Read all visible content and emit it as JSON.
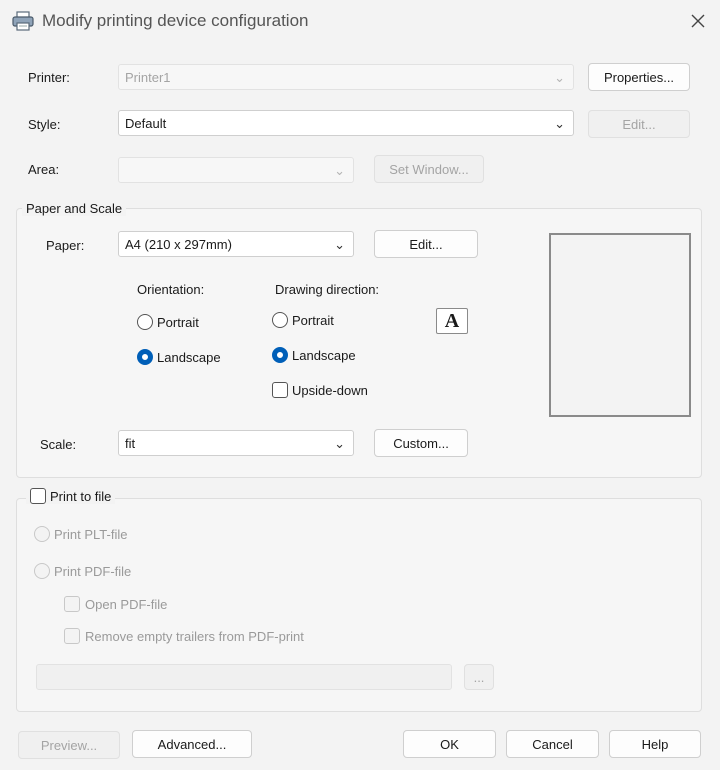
{
  "window": {
    "title": "Modify printing device configuration"
  },
  "printer": {
    "label": "Printer:",
    "value": "Printer1",
    "properties_label": "Properties..."
  },
  "style": {
    "label": "Style:",
    "value": "Default",
    "edit_label": "Edit..."
  },
  "area": {
    "label": "Area:",
    "value": "",
    "set_window_label": "Set Window..."
  },
  "paper_scale": {
    "title": "Paper and Scale",
    "paper_label": "Paper:",
    "paper_value": "A4 (210 x 297mm)",
    "paper_edit_label": "Edit...",
    "orientation": {
      "label": "Orientation:",
      "portrait": "Portrait",
      "landscape": "Landscape",
      "selected": "Landscape"
    },
    "drawing_direction": {
      "label": "Drawing direction:",
      "portrait": "Portrait",
      "landscape": "Landscape",
      "upside_down": "Upside-down",
      "selected": "Landscape",
      "upside_down_checked": false
    },
    "direction_icon": "A",
    "scale_label": "Scale:",
    "scale_value": "fit",
    "custom_label": "Custom..."
  },
  "print_to_file": {
    "label": "Print to file",
    "checked": false,
    "plt_label": "Print PLT-file",
    "pdf_label": "Print PDF-file",
    "open_pdf_label": "Open PDF-file",
    "remove_trailers_label": "Remove empty trailers from PDF-print",
    "file_path": "",
    "browse_label": "..."
  },
  "footer": {
    "preview_label": "Preview...",
    "advanced_label": "Advanced...",
    "ok_label": "OK",
    "cancel_label": "Cancel",
    "help_label": "Help"
  },
  "colors": {
    "accent": "#005fb8",
    "background": "#f3f3f3",
    "disabled_text": "#9a9a9a"
  }
}
